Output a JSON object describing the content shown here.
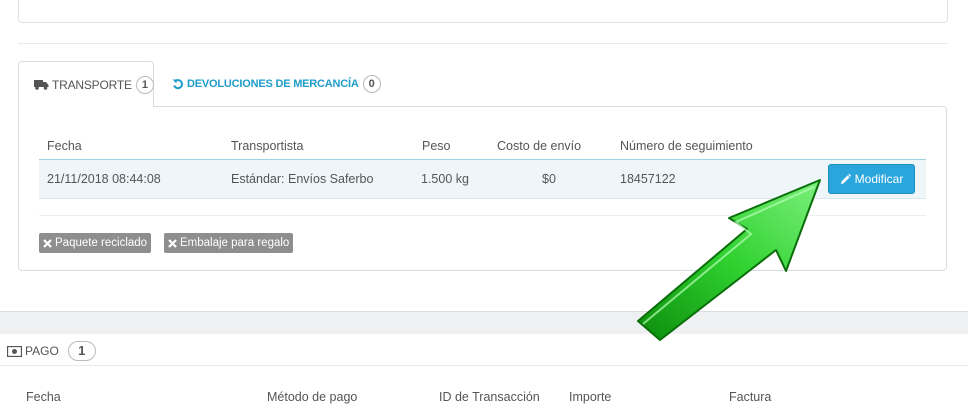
{
  "shipping_tabs": {
    "transport": {
      "label": "Transporte",
      "count": "1"
    },
    "returns": {
      "label": "Devoluciones de mercancía",
      "count": "0"
    }
  },
  "shipping_table": {
    "headers": [
      "Fecha",
      "Transportista",
      "Peso",
      "Costo de envío",
      "Número de seguimiento"
    ],
    "row": {
      "date": "21/11/2018 08:44:08",
      "carrier": "Estándar: Envíos Saferbo",
      "weight": "1.500 kg",
      "cost": "$0",
      "tracking": "18457122",
      "edit_label": "Modificar"
    }
  },
  "options": {
    "recycled": "Paquete reciclado",
    "gift": "Embalaje para regalo"
  },
  "payment": {
    "title": "Pago",
    "count": "1",
    "headers": [
      "Fecha",
      "Método de pago",
      "ID de Transacción",
      "Importe",
      "Factura"
    ]
  },
  "colors": {
    "accent": "#2ba6dc",
    "link": "#1e9cc8",
    "tag": "#8e8e8e",
    "arrow": "#2fd12f"
  },
  "icons": {
    "truck": "truck-icon",
    "undo": "undo-icon",
    "pencil": "pencil-icon",
    "close": "close-icon",
    "money": "money-icon"
  }
}
